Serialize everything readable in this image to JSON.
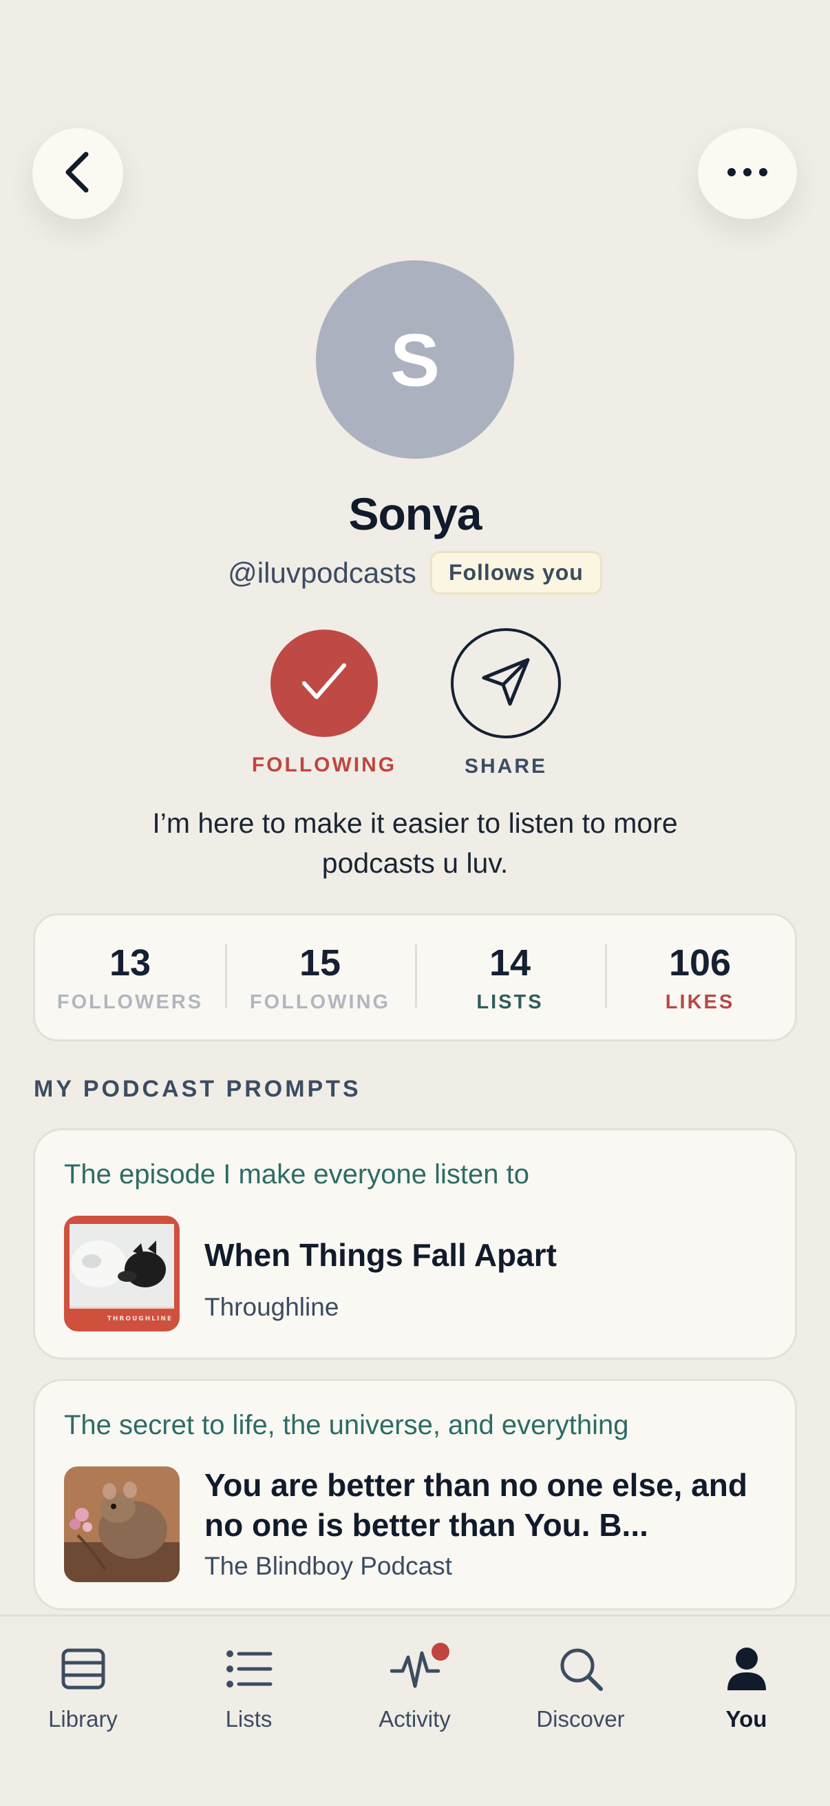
{
  "header": {
    "back_icon": "chevron-left-icon",
    "more_icon": "ellipsis-icon"
  },
  "profile": {
    "avatar_initial": "S",
    "avatar_color": "#abb1bf",
    "name": "Sonya",
    "handle": "@iluvpodcasts",
    "follows_badge": "Follows you",
    "bio": "I’m here to make it easier to listen to more podcasts u luv."
  },
  "actions": {
    "following_label": "FOLLOWING",
    "share_label": "SHARE",
    "following_color": "#bf4a45"
  },
  "stats": [
    {
      "value": "13",
      "label": "FOLLOWERS"
    },
    {
      "value": "15",
      "label": "FOLLOWING"
    },
    {
      "value": "14",
      "label": "LISTS"
    },
    {
      "value": "106",
      "label": "LIKES"
    }
  ],
  "prompts": {
    "section_title": "MY PODCAST PROMPTS",
    "items": [
      {
        "prompt": "The episode I make everyone listen to",
        "episode_title": "When Things Fall Apart",
        "show": "Throughline",
        "art_text": "THROUGHLINE"
      },
      {
        "prompt": "The secret to life, the universe, and everything",
        "episode_title": "You are better than no one else, and no one is better than You. B...",
        "show": "The Blindboy Podcast"
      }
    ]
  },
  "tabbar": {
    "tabs": [
      {
        "label": "Library",
        "icon": "library-icon"
      },
      {
        "label": "Lists",
        "icon": "list-icon"
      },
      {
        "label": "Activity",
        "icon": "activity-icon"
      },
      {
        "label": "Discover",
        "icon": "search-icon"
      },
      {
        "label": "You",
        "icon": "person-icon",
        "active": true
      }
    ]
  }
}
